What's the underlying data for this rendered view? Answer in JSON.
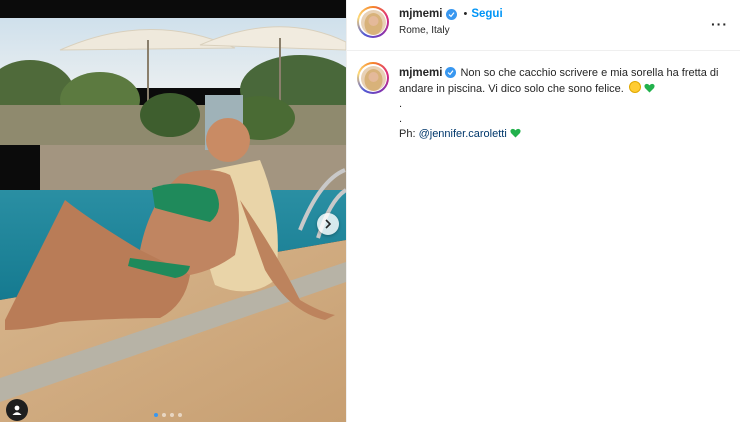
{
  "post": {
    "username": "mjmemi",
    "follow_label": "Segui",
    "separator": "•",
    "location": "Rome, Italy",
    "more_label": "···",
    "caption": {
      "username": "mjmemi",
      "line1": "Non so che cacchio scrivere e mia sorella ha fretta di andare in piscina. Vi dico solo che sono felice.",
      "dot1": ".",
      "dot2": ".",
      "credit_prefix": "Ph:",
      "mention": "@jennifer.caroletti"
    },
    "carousel": {
      "total_slides": 4,
      "active_slide": 1
    },
    "icons": [
      "verified-badge-icon",
      "more-options-icon",
      "next-arrow-icon",
      "user-tag-icon",
      "smile-emoji-icon",
      "green-heart-icon"
    ],
    "colors": {
      "link": "#0095f6",
      "mention": "#00376b",
      "verified": "#3897f0",
      "heart": "#22b14c"
    }
  }
}
